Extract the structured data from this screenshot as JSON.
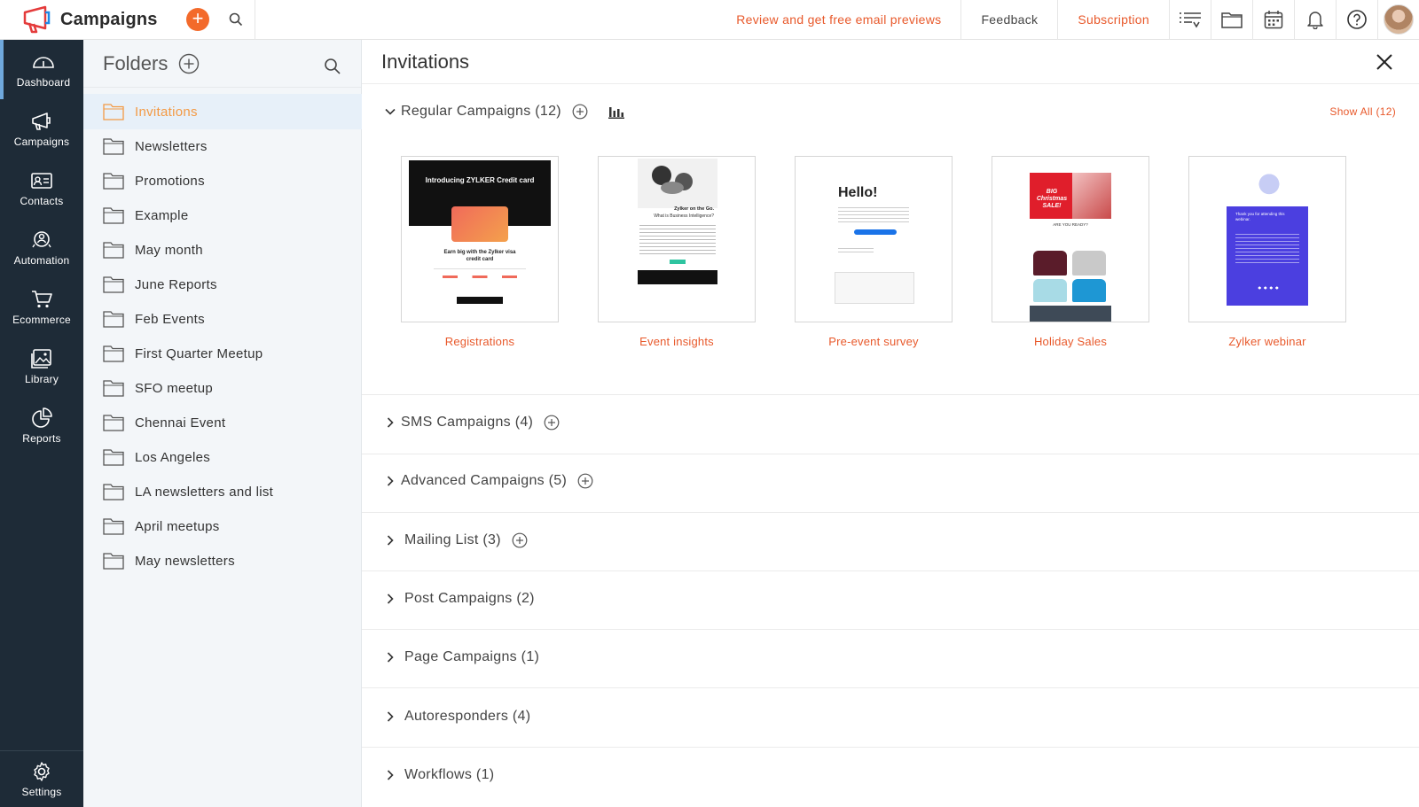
{
  "app": {
    "name": "Campaigns"
  },
  "topbar": {
    "review_link": "Review and get free email previews",
    "feedback_link": "Feedback",
    "subscription_link": "Subscription",
    "accent": "#e8592b"
  },
  "nav": {
    "items": [
      {
        "label": "Dashboard",
        "icon": "dashboard-icon"
      },
      {
        "label": "Campaigns",
        "icon": "megaphone-icon"
      },
      {
        "label": "Contacts",
        "icon": "contact-card-icon"
      },
      {
        "label": "Automation",
        "icon": "automation-icon"
      },
      {
        "label": "Ecommerce",
        "icon": "cart-icon"
      },
      {
        "label": "Library",
        "icon": "image-icon"
      },
      {
        "label": "Reports",
        "icon": "pie-chart-icon"
      }
    ],
    "settings": "Settings"
  },
  "folders": {
    "title": "Folders",
    "selected": "Invitations",
    "items": [
      "Invitations",
      "Newsletters",
      "Promotions",
      "Example",
      "May month",
      "June Reports",
      "Feb Events",
      "First Quarter Meetup",
      "SFO meetup",
      "Chennai Event",
      "Los Angeles",
      "LA newsletters and list",
      "April meetups",
      "May newsletters"
    ]
  },
  "main": {
    "title": "Invitations",
    "regular": {
      "label": "Regular Campaigns (12)",
      "show_all": "Show All (12)",
      "cards": [
        {
          "label": "Registrations",
          "thumb_heading": "Introducing ZYLKER Credit card",
          "thumb_text": "Earn big with the Zylker visa credit card"
        },
        {
          "label": "Event insights",
          "thumb_heading": "Zylker on the Go.",
          "thumb_text": "What is Business Intelligence?"
        },
        {
          "label": "Pre-event survey",
          "thumb_heading": "Hello!",
          "thumb_text": ""
        },
        {
          "label": "Holiday Sales",
          "thumb_heading": "BIG Christmas SALE!",
          "thumb_text": "ARE YOU READY?"
        },
        {
          "label": "Zylker webinar",
          "thumb_heading": "Thank you for attending this webinar.",
          "thumb_text": ""
        }
      ]
    },
    "sections": [
      {
        "label": "SMS Campaigns (4)",
        "addable": true
      },
      {
        "label": "Advanced Campaigns (5)",
        "addable": true
      },
      {
        "label": "Mailing List (3)",
        "addable": true
      },
      {
        "label": "Post Campaigns (2)",
        "addable": false
      },
      {
        "label": "Page Campaigns (1)",
        "addable": false
      },
      {
        "label": "Autoresponders (4)",
        "addable": false
      },
      {
        "label": "Workflows (1)",
        "addable": false
      }
    ]
  }
}
